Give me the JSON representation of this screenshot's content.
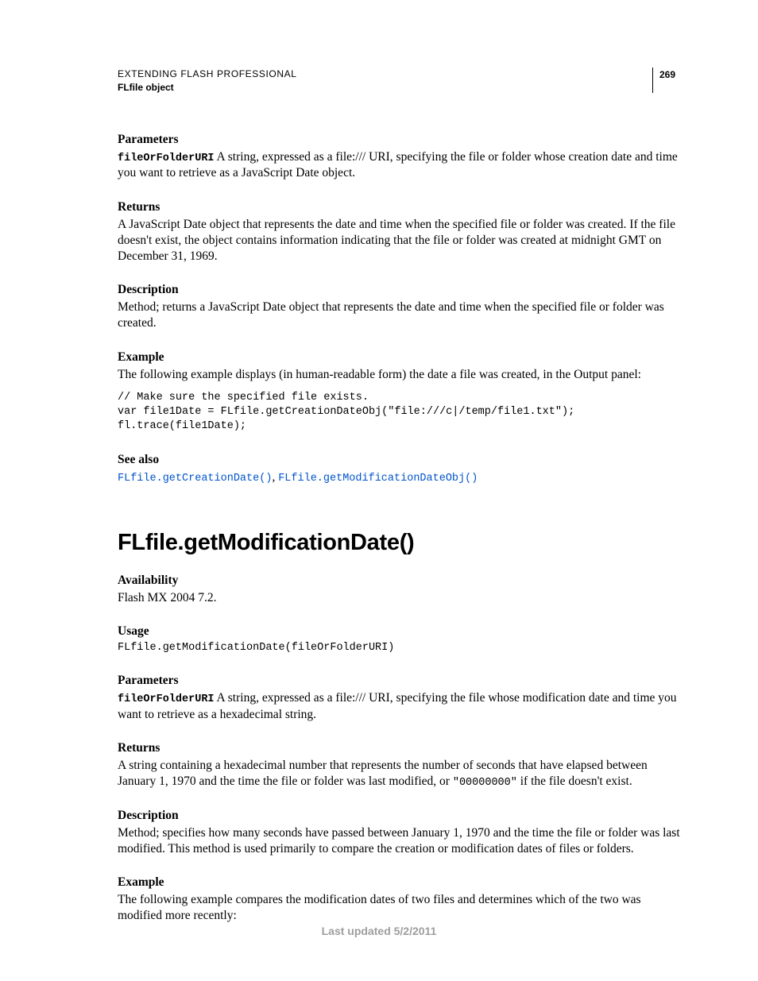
{
  "header": {
    "title": "EXTENDING FLASH PROFESSIONAL",
    "subtitle": "FLfile object",
    "page_number": "269"
  },
  "section1": {
    "parameters_heading": "Parameters",
    "param_name": "fileOrFolderURI",
    "param_text": "  A string, expressed as a file:/// URI, specifying the file or folder whose creation date and time you want to retrieve as a JavaScript Date object.",
    "returns_heading": "Returns",
    "returns_text": "A JavaScript Date object that represents the date and time when the specified file or folder was created. If the file doesn't exist, the object contains information indicating that the file or folder was created at midnight GMT on December 31, 1969.",
    "description_heading": "Description",
    "description_text": "Method; returns a JavaScript Date object that represents the date and time when the specified file or folder was created.",
    "example_heading": "Example",
    "example_text": "The following example displays (in human-readable form) the date a file was created, in the Output panel:",
    "example_code": "// Make sure the specified file exists.\nvar file1Date = FLfile.getCreationDateObj(\"file:///c|/temp/file1.txt\");\nfl.trace(file1Date);",
    "seealso_heading": "See also",
    "seealso_link1": "FLfile.getCreationDate()",
    "seealso_link2": "FLfile.getModificationDateObj()"
  },
  "method_title": "FLfile.getModificationDate()",
  "section2": {
    "availability_heading": "Availability",
    "availability_text": "Flash MX 2004 7.2.",
    "usage_heading": "Usage",
    "usage_code": "FLfile.getModificationDate(fileOrFolderURI)",
    "parameters_heading": "Parameters",
    "param_name": "fileOrFolderURI",
    "param_text": "  A string, expressed as a file:/// URI, specifying the file whose modification date and time you want to retrieve as a hexadecimal string.",
    "returns_heading": "Returns",
    "returns_text_a": "A string containing a hexadecimal number that represents the number of seconds that have elapsed between January 1, 1970 and the time the file or folder was last modified, or ",
    "returns_code": "\"00000000\"",
    "returns_text_b": " if the file doesn't exist.",
    "description_heading": "Description",
    "description_text": "Method; specifies how many seconds have passed between January 1, 1970 and the time the file or folder was last modified. This method is used primarily to compare the creation or modification dates of files or folders.",
    "example_heading": "Example",
    "example_text": "The following example compares the modification dates of two files and determines which of the two was modified more recently:"
  },
  "footer": "Last updated 5/2/2011"
}
